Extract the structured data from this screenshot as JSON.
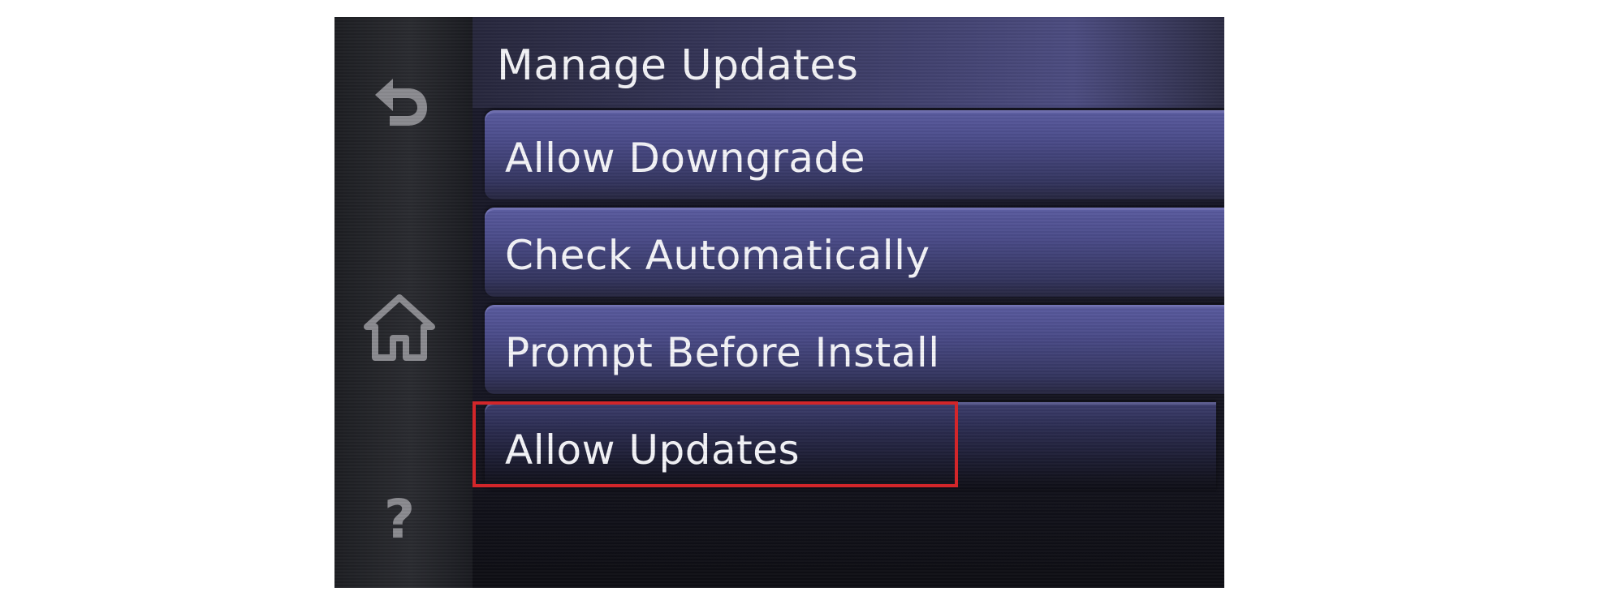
{
  "screen": {
    "title": "Manage Updates",
    "menu_items": [
      {
        "label": "Allow Downgrade"
      },
      {
        "label": "Check Automatically"
      },
      {
        "label": "Prompt Before Install"
      },
      {
        "label": "Allow Updates"
      }
    ],
    "side_buttons": {
      "back_icon": "back-arrow-icon",
      "home_icon": "home-icon",
      "help_glyph": "?"
    },
    "highlighted_item": "Allow Updates",
    "colors": {
      "highlight_border": "#d2262a",
      "row_accent": "#4a4b88",
      "side_icon": "#8a8a8f"
    }
  }
}
